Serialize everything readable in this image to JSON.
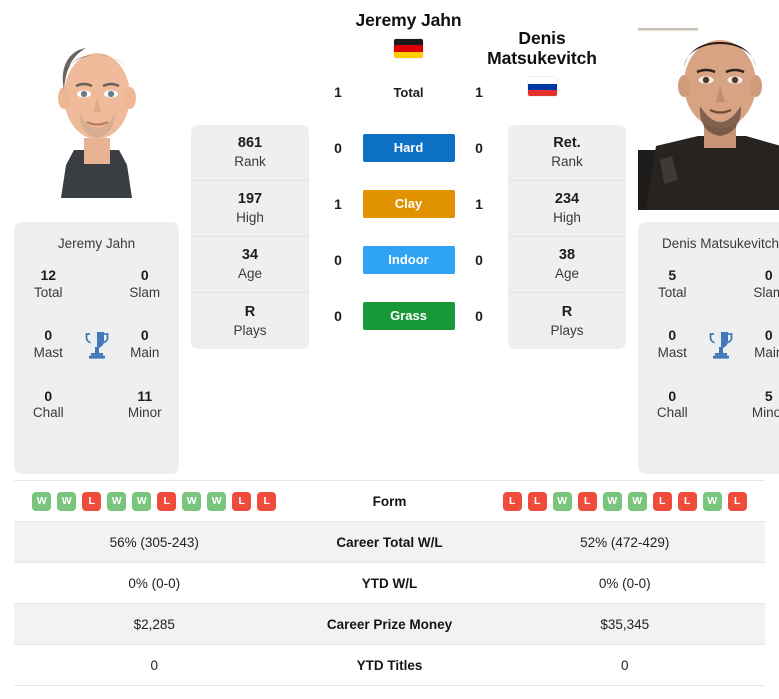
{
  "players": {
    "left": {
      "name": "Jeremy Jahn",
      "name_lines": [
        "Jeremy Jahn"
      ],
      "country": "Germany",
      "flag_icon": "flag-germany",
      "flag_colors": [
        "#1a1a1a",
        "#dd0000",
        "#ffce00"
      ],
      "photo_alt": "Jeremy Jahn headshot",
      "rank": "861",
      "rank_label": "Rank",
      "high": "197",
      "high_label": "High",
      "age": "34",
      "age_label": "Age",
      "plays": "R",
      "plays_label": "Plays",
      "titles": {
        "name": "Jeremy Jahn",
        "total": "12",
        "total_label": "Total",
        "slam": "0",
        "slam_label": "Slam",
        "mast": "0",
        "mast_label": "Mast",
        "main": "0",
        "main_label": "Main",
        "chall": "0",
        "chall_label": "Chall",
        "minor": "11",
        "minor_label": "Minor"
      },
      "h2h": {
        "total": "1",
        "hard": "0",
        "clay": "1",
        "indoor": "0",
        "grass": "0"
      },
      "form": [
        "W",
        "W",
        "L",
        "W",
        "W",
        "L",
        "W",
        "W",
        "L",
        "L"
      ],
      "career_wl": "56% (305-243)",
      "ytd_wl": "0% (0-0)",
      "career_prize": "$2,285",
      "ytd_titles": "0"
    },
    "right": {
      "name": "Denis Matsukevitch",
      "name_lines": [
        "Denis",
        "Matsukevitch"
      ],
      "country": "Russia",
      "flag_icon": "flag-russia",
      "flag_colors": [
        "#ffffff",
        "#0039a6",
        "#e4312b"
      ],
      "photo_alt": "Denis Matsukevitch headshot",
      "rank": "Ret.",
      "rank_label": "Rank",
      "high": "234",
      "high_label": "High",
      "age": "38",
      "age_label": "Age",
      "plays": "R",
      "plays_label": "Plays",
      "titles": {
        "name": "Denis Matsukevitch",
        "total": "5",
        "total_label": "Total",
        "slam": "0",
        "slam_label": "Slam",
        "mast": "0",
        "mast_label": "Mast",
        "main": "0",
        "main_label": "Main",
        "chall": "0",
        "chall_label": "Chall",
        "minor": "5",
        "minor_label": "Minor"
      },
      "h2h": {
        "total": "1",
        "hard": "0",
        "clay": "1",
        "indoor": "0",
        "grass": "0"
      },
      "form": [
        "L",
        "L",
        "W",
        "L",
        "W",
        "W",
        "L",
        "L",
        "W",
        "L"
      ],
      "career_wl": "52% (472-429)",
      "ytd_wl": "0% (0-0)",
      "career_prize": "$35,345",
      "ytd_titles": "0"
    }
  },
  "h2h_rows": [
    {
      "key": "total",
      "label": "Total",
      "badge": false,
      "color": ""
    },
    {
      "key": "hard",
      "label": "Hard",
      "badge": true,
      "color": "#0c71c3"
    },
    {
      "key": "clay",
      "label": "Clay",
      "badge": true,
      "color": "#e09200"
    },
    {
      "key": "indoor",
      "label": "Indoor",
      "badge": true,
      "color": "#2fa4f5"
    },
    {
      "key": "grass",
      "label": "Grass",
      "badge": true,
      "color": "#189938"
    }
  ],
  "table": {
    "form_label": "Form",
    "career_wl_label": "Career Total W/L",
    "ytd_wl_label": "YTD W/L",
    "career_prize_label": "Career Prize Money",
    "ytd_titles_label": "YTD Titles"
  },
  "colors": {
    "win_badge": "#79c57e",
    "loss_badge": "#ef4c3c",
    "card_bg": "#efefef",
    "row_shade": "#f2f2f2",
    "trophy": "#4279b8"
  }
}
